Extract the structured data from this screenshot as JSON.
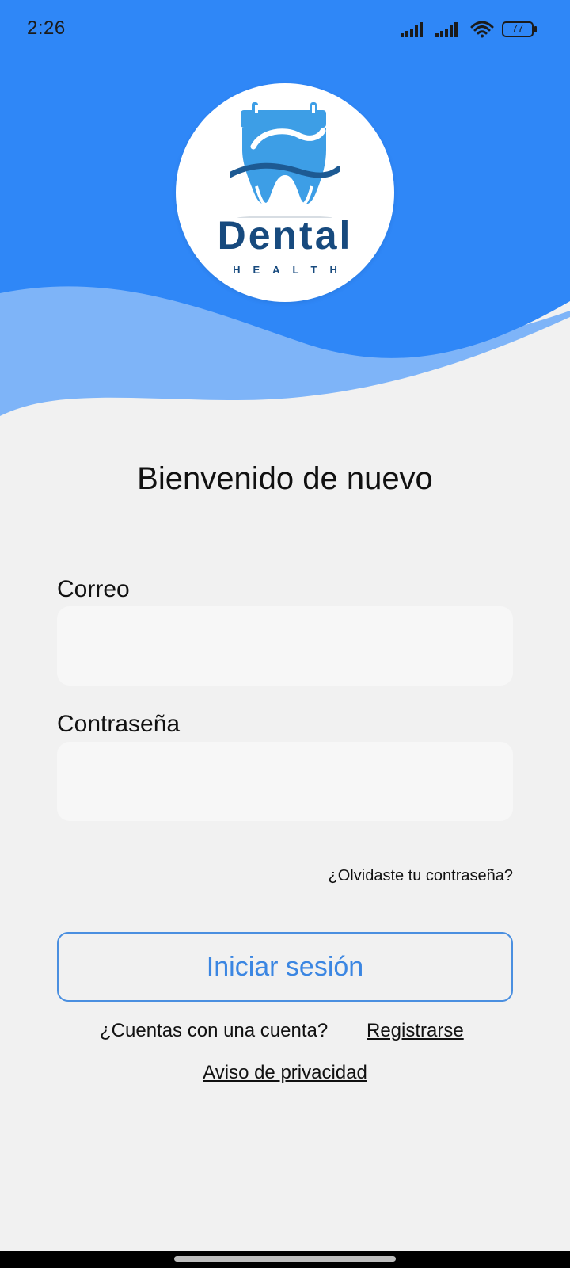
{
  "status_bar": {
    "time": "2:26",
    "battery_level": "77",
    "icons": [
      "signal-icon",
      "signal-icon",
      "wifi-icon",
      "battery-icon"
    ]
  },
  "colors": {
    "header_primary": "#2f87f7",
    "header_wave_light": "#7eb4f8",
    "background": "#f1f1f1",
    "button_accent": "#3b86e2",
    "logo_dark": "#174a7e"
  },
  "logo": {
    "word": "Dental",
    "subtitle": "HEALTH",
    "icon": "tooth-calendar-icon"
  },
  "login": {
    "title": "Bienvenido de nuevo",
    "email_label": "Correo",
    "email_value": "",
    "password_label": "Contraseña",
    "password_value": "",
    "forgot_password": "¿Olvidaste tu contraseña?",
    "submit_label": "Iniciar sesión",
    "register_prompt": "¿Cuentas con una cuenta?",
    "register_link": "Registrarse",
    "privacy_link": "Aviso de privacidad"
  }
}
